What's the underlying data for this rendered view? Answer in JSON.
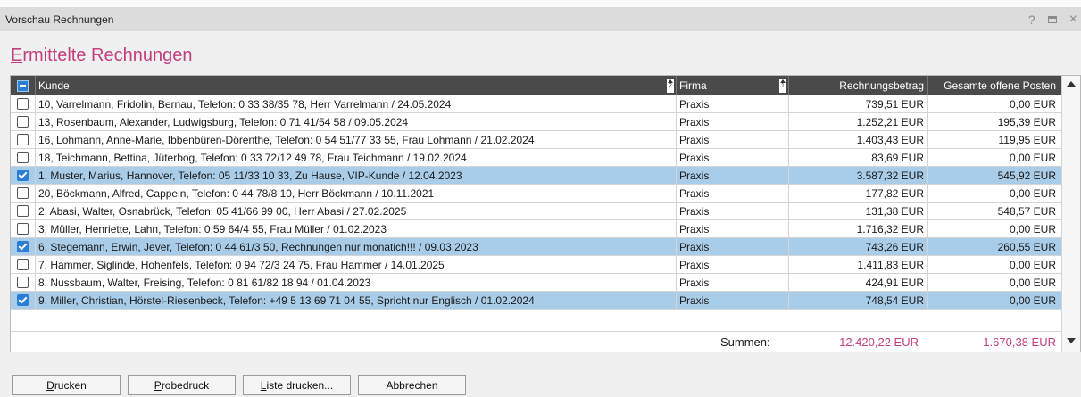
{
  "window": {
    "title": "Vorschau Rechnungen",
    "help_icon": "?",
    "maximize_icon": "maximize-icon",
    "close_icon": "×"
  },
  "heading": {
    "first": "E",
    "rest": "rmittelte Rechnungen"
  },
  "table": {
    "columns": {
      "kunde": "Kunde",
      "kunde_sort": "2",
      "firma": "Firma",
      "firma_sort": "1",
      "betrag": "Rechnungsbetrag",
      "offen": "Gesamte offene Posten"
    },
    "rows": [
      {
        "checked": false,
        "kunde": "10, Varrelmann, Fridolin, Bernau, Telefon: 0 33 38/35 78, Herr Varrelmann / 24.05.2024",
        "firma": "Praxis",
        "betrag": "739,51 EUR",
        "offen": "0,00 EUR"
      },
      {
        "checked": false,
        "kunde": "13, Rosenbaum, Alexander, Ludwigsburg, Telefon: 0 71 41/54 58 / 09.05.2024",
        "firma": "Praxis",
        "betrag": "1.252,21 EUR",
        "offen": "195,39 EUR"
      },
      {
        "checked": false,
        "kunde": "16, Lohmann, Anne-Marie, Ibbenbüren-Dörenthe, Telefon: 0 54 51/77 33 55, Frau Lohmann / 21.02.2024",
        "firma": "Praxis",
        "betrag": "1.403,43 EUR",
        "offen": "119,95 EUR"
      },
      {
        "checked": false,
        "kunde": "18, Teichmann, Bettina, Jüterbog, Telefon: 0 33 72/12 49 78, Frau Teichmann / 19.02.2024",
        "firma": "Praxis",
        "betrag": "83,69 EUR",
        "offen": "0,00 EUR"
      },
      {
        "checked": true,
        "kunde": "1, Muster, Marius, Hannover, Telefon: 05 11/33 10 33, Zu Hause, VIP-Kunde / 12.04.2023",
        "firma": "Praxis",
        "betrag": "3.587,32 EUR",
        "offen": "545,92 EUR"
      },
      {
        "checked": false,
        "kunde": "20, Böckmann, Alfred, Cappeln, Telefon: 0 44 78/8 10, Herr Böckmann / 10.11.2021",
        "firma": "Praxis",
        "betrag": "177,82 EUR",
        "offen": "0,00 EUR"
      },
      {
        "checked": false,
        "kunde": "2, Abasi, Walter, Osnabrück, Telefon: 05 41/66 99 00, Herr Abasi / 27.02.2025",
        "firma": "Praxis",
        "betrag": "131,38 EUR",
        "offen": "548,57 EUR"
      },
      {
        "checked": false,
        "kunde": "3, Müller, Henriette, Lahn, Telefon: 0 59 64/4 55, Frau Müller / 01.02.2023",
        "firma": "Praxis",
        "betrag": "1.716,32 EUR",
        "offen": "0,00 EUR"
      },
      {
        "checked": true,
        "kunde": "6, Stegemann, Erwin, Jever, Telefon: 0 44 61/3 50, Rechnungen nur monatich!!! / 09.03.2023",
        "firma": "Praxis",
        "betrag": "743,26 EUR",
        "offen": "260,55 EUR"
      },
      {
        "checked": false,
        "kunde": "7, Hammer, Siglinde, Hohenfels, Telefon: 0 94 72/3 24 75, Frau Hammer / 14.01.2025",
        "firma": "Praxis",
        "betrag": "1.411,83 EUR",
        "offen": "0,00 EUR"
      },
      {
        "checked": false,
        "kunde": "8, Nussbaum, Walter, Freising, Telefon: 0 81 61/82 18 94 / 01.04.2023",
        "firma": "Praxis",
        "betrag": "424,91 EUR",
        "offen": "0,00 EUR"
      },
      {
        "checked": true,
        "kunde": "9, Miller, Christian, Hörstel-Riesenbeck, Telefon: +49 5 13 69 71 04 55, Spricht nur Englisch / 01.02.2024",
        "firma": "Praxis",
        "betrag": "748,54 EUR",
        "offen": "0,00 EUR"
      }
    ],
    "summen_label": "Summen:",
    "summen_betrag": "12.420,22 EUR",
    "summen_offen": "1.670,38 EUR"
  },
  "buttons": {
    "drucken": {
      "u": "D",
      "rest": "rucken"
    },
    "probedruck": {
      "u": "P",
      "rest": "robedruck"
    },
    "liste": {
      "u": "L",
      "rest": "iste drucken..."
    },
    "abbrechen": "Abbrechen"
  },
  "colors": {
    "accent": "#c2407e",
    "selected_row": "#a9cde9",
    "header_bg": "#4a4a4a",
    "checkbox_on": "#2a7fd4"
  }
}
